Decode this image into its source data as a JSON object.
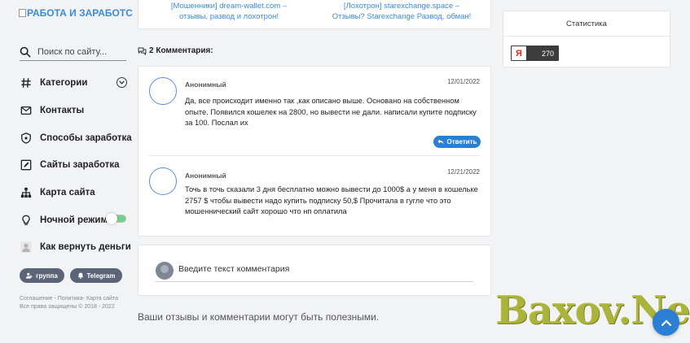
{
  "site": {
    "logo_text": "РАБОТА И ЗАРАБОТС"
  },
  "sidebar": {
    "search_placeholder": "Поиск по сайту...",
    "items": [
      {
        "label": "Категории",
        "icon": "hash-icon"
      },
      {
        "label": "Контакты",
        "icon": "mail-icon"
      },
      {
        "label": "Способы заработка",
        "icon": "shield-icon"
      },
      {
        "label": "Сайты заработка",
        "icon": "edit-icon"
      },
      {
        "label": "Карта сайта",
        "icon": "sitemap-icon"
      },
      {
        "label": "Ночной режим",
        "icon": "bulb-icon"
      },
      {
        "label": "Как вернуть деньги",
        "icon": "user-icon"
      }
    ],
    "buttons": {
      "group": "группа",
      "telegram": "Telegram"
    },
    "footer_line1": "Соглашение - Политика- Карта сайта",
    "footer_line2": "Все права защищены © 2018 - 2022"
  },
  "related": {
    "left_line1": "[Мошенники] dream-wallet.com –",
    "left_line2": "отзывы, развод и лохотрон!",
    "right_line1": "[Лохотрон] starexchange.space –",
    "right_line2": "Отзывы? Starexchange Развод, обман!"
  },
  "comments": {
    "heading": "2 Комментария:",
    "items": [
      {
        "author": "Анонимный",
        "date": "12/01/2022",
        "text": "Да, все происходит именно так ,как описано выше. Основано на собственном опыте. Появился кошелек на 2800, но вывести не дали. написали купите подписку за 100. Послал их"
      },
      {
        "author": "Анонимный",
        "date": "12/21/2022",
        "text": "Точь в точь сказали 3 дня бесплатно можно вывести до 1000$ а у меня в кошельке 2757 $ чтобы вывести надо купить подписку 50,$ Прочитала в гугле что это мошеннический сайт хорошо что нп оплатила"
      }
    ],
    "reply_label": "Ответить",
    "input_placeholder": "Введите текст комментария",
    "bottom_note": "Ваши отзывы и комментарии могут быть полезными."
  },
  "stats": {
    "title": "Статистика",
    "counter_logo": "Я",
    "counter_value": "270"
  },
  "watermark": "Baxov.Net",
  "colors": {
    "accent": "#2a7fd4",
    "link": "#3a8be0",
    "pill": "#5b6577"
  }
}
